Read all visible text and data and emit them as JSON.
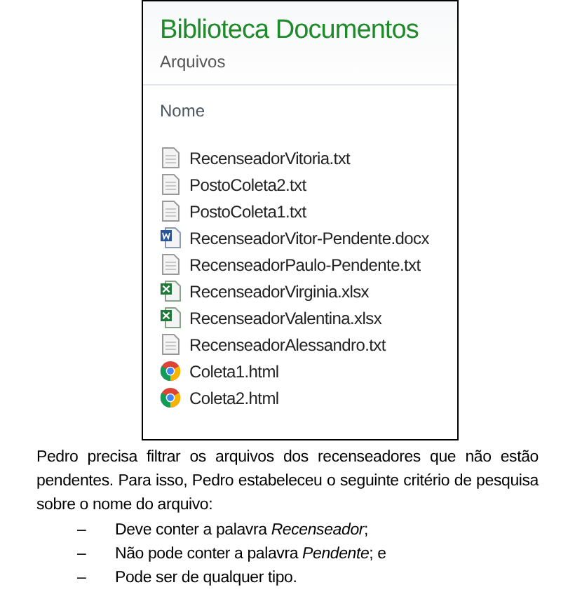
{
  "library": {
    "title": "Biblioteca Documentos",
    "subtitle": "Arquivos",
    "column_header": "Nome",
    "files": [
      {
        "name": "RecenseadorVitoria.txt",
        "kind": "text"
      },
      {
        "name": "PostoColeta2.txt",
        "kind": "text"
      },
      {
        "name": "PostoColeta1.txt",
        "kind": "text"
      },
      {
        "name": "RecenseadorVitor-Pendente.docx",
        "kind": "word"
      },
      {
        "name": "RecenseadorPaulo-Pendente.txt",
        "kind": "text"
      },
      {
        "name": "RecenseadorVirginia.xlsx",
        "kind": "excel"
      },
      {
        "name": "RecenseadorValentina.xlsx",
        "kind": "excel"
      },
      {
        "name": "RecenseadorAlessandro.txt",
        "kind": "text"
      },
      {
        "name": "Coleta1.html",
        "kind": "web"
      },
      {
        "name": "Coleta2.html",
        "kind": "web"
      }
    ]
  },
  "question": {
    "paragraph": "Pedro precisa filtrar os arquivos dos recenseadores que não estão pendentes. Para isso, Pedro estabeleceu o seguinte critério de pesquisa sobre o nome do arquivo:",
    "criteria": [
      {
        "dash": "–",
        "text": "Deve conter a palavra *Recenseador*;"
      },
      {
        "dash": "–",
        "text": "Não pode conter a palavra *Pendente*; e"
      },
      {
        "dash": "–",
        "text": "Pode ser de qualquer tipo."
      }
    ]
  }
}
